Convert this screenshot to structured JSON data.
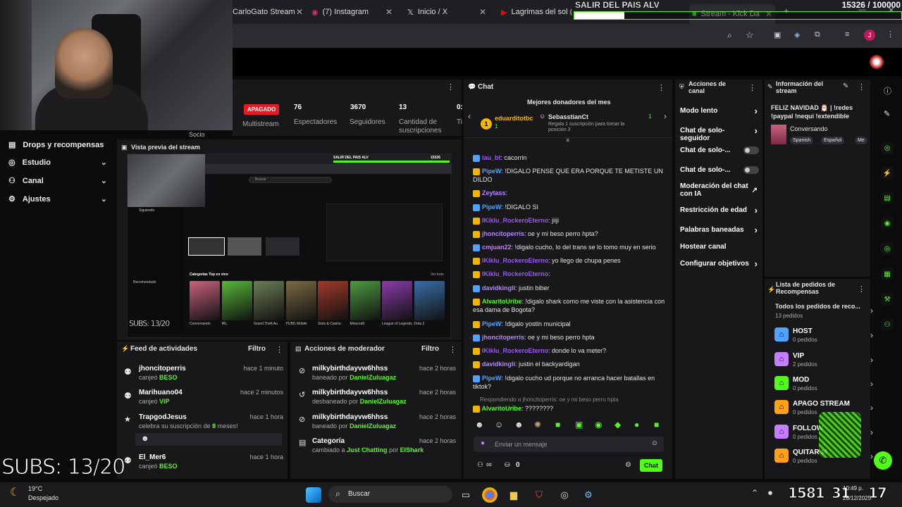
{
  "browser": {
    "tabs": [
      {
        "label": "CarloGato Stream"
      },
      {
        "label": "(7) Instagram"
      },
      {
        "label": "Inicio / X"
      },
      {
        "label": "Lagrimas del sol ("
      },
      {
        "label": "Stream - Kick Da"
      }
    ],
    "profile_initial": "J"
  },
  "overlay": {
    "goal_title": "SALIR DEL PAIS ALV",
    "goal_progress": "15326 / 100000",
    "goal_fraction": 0.153,
    "subs_big": "SUBS: 13/20",
    "subs_small": "SUBS: 13/20",
    "bottom_counter": "1581",
    "bottom_counter2": "31",
    "bottom_counter3": "17",
    "bottom_label1": "Socio"
  },
  "sidebar": {
    "items": [
      {
        "label": "Drops y recompensas",
        "icon": "gift-icon"
      },
      {
        "label": "Estudio",
        "icon": "target-icon"
      },
      {
        "label": "Canal",
        "icon": "people-icon"
      },
      {
        "label": "Ajustes",
        "icon": "gear-icon"
      }
    ]
  },
  "stats": {
    "status_badge": "APAGADO",
    "status_label": "Multistream",
    "viewers": "76",
    "viewers_label": "Espectadores",
    "followers": "3670",
    "followers_label": "Seguidores",
    "subs": "13",
    "subs_label": "Cantidad de suscripciones",
    "time": "0:",
    "time_label": "Ti"
  },
  "preview": {
    "title": "Vista previa del stream",
    "search_placeholder": "Buscar",
    "inner_title": "SALIR DEL PAIS ALV",
    "inner_progress": "15326",
    "categories_title": "Categorías Top en vivo",
    "see_all": "Ver todo",
    "following": "Siguiendo",
    "recommended": "Recomendado",
    "subs_overlay": "SUBS: 13/20",
    "categories": [
      {
        "label": "Conversando",
        "color": "#c9637d"
      },
      {
        "label": "IRL",
        "color": "#58b83a"
      },
      {
        "label": "Grand Theft Au",
        "color": "#6d7e55"
      },
      {
        "label": "PUBG Mobile",
        "color": "#7b6a44"
      },
      {
        "label": "Slots & Casino",
        "color": "#a23a2a"
      },
      {
        "label": "Minecraft",
        "color": "#4d9b40"
      },
      {
        "label": "League of Legends",
        "color": "#8a3ca9"
      },
      {
        "label": "Dota 2",
        "color": "#3a6fa8"
      }
    ]
  },
  "feed": {
    "title": "Feed de actividades",
    "filter": "Filtro",
    "items": [
      {
        "name": "jhoncitoperris",
        "action": "canjeó",
        "highlight": "BESO",
        "time": "hace 1 minuto"
      },
      {
        "name": "Marihuano04",
        "action": "canjeó",
        "highlight": "VIP",
        "time": "hace 2 minutos"
      },
      {
        "name": "TrapgodJesus",
        "action": "celebra su suscripción de",
        "highlight": "8",
        "action2": "meses!",
        "time": "hace 1 hora"
      },
      {
        "name": "El_Mer6",
        "action": "canjeó",
        "highlight": "BESO",
        "time": "hace 1 hora"
      }
    ]
  },
  "mod_actions": {
    "title": "Acciones de moderador",
    "filter": "Filtro",
    "items": [
      {
        "name": "milkybirthdayvw6hhss",
        "action": "baneado por",
        "by": "DanielZuluagaz",
        "time": "hace 2 horas"
      },
      {
        "name": "milkybirthdayvw6hhss",
        "action": "desbaneado por",
        "by": "DanielZuluagaz",
        "time": "hace 2 horas"
      },
      {
        "name": "milkybirthdayvw6hhss",
        "action": "baneado por",
        "by": "DanielZuluagaz",
        "time": "hace 2 horas"
      },
      {
        "name": "Categoría",
        "action": "cambiado a",
        "by": "Just Chatting",
        "action2": "por",
        "by2": "ElShark",
        "time": "hace 2 horas"
      }
    ]
  },
  "chat": {
    "title": "Chat",
    "donors_title": "Mejores donadores del mes",
    "donor1": "eduarditotbc",
    "donor1_count": "1",
    "donor2": "SebasstianCt",
    "donor2_count": "1",
    "donor2_sub": "Regala 1 suscripción para tomar la posición 3",
    "messages": [
      {
        "user": "lau_bt",
        "color": "#9b59f5",
        "text": "cacorrin"
      },
      {
        "user": "PipeW",
        "color": "#4fa3ff",
        "text": "!DIGALO PENSE QUE ERA PORQUE TE METISTE UN DILDO"
      },
      {
        "user": "Zeytass",
        "color": "#b388ff",
        "text": ""
      },
      {
        "user": "PipeW",
        "color": "#4fa3ff",
        "text": "!DIGALO SI"
      },
      {
        "user": "IKiklu_RockeroEterno",
        "color": "#9b59f5",
        "text": "jiiji"
      },
      {
        "user": "jhoncitoperris",
        "color": "#b388ff",
        "text": "oe y mi beso perro hpta?"
      },
      {
        "user": "cmjuan22",
        "color": "#c77dff",
        "text": "!digalo cucho, lo del trans se lo tomo muy en serio"
      },
      {
        "user": "IKiklu_RockeroEterno",
        "color": "#9b59f5",
        "text": "yo llego de chupa penes"
      },
      {
        "user": "IKiklu_RockeroEterno",
        "color": "#9b59f5",
        "text": ""
      },
      {
        "user": "davidkingli",
        "color": "#b388ff",
        "text": "justin biber"
      },
      {
        "user": "AlvaritoUribe",
        "color": "#53fc18",
        "text": "!digalo shark como me viste con la asistencia con esa dama de Bogota?"
      },
      {
        "user": "PipeW",
        "color": "#4fa3ff",
        "text": "!digalo yostin municipal"
      },
      {
        "user": "jhoncitoperris",
        "color": "#b388ff",
        "text": "oe y mi beso perro hpta"
      },
      {
        "user": "IKiklu_RockeroEterno",
        "color": "#9b59f5",
        "text": "donde lo va meter?"
      },
      {
        "user": "davidkingli",
        "color": "#b388ff",
        "text": "justin el backyardigan"
      },
      {
        "user": "PipeW",
        "color": "#4fa3ff",
        "text": "!digalo cucho ud porque no arranca hacer batallas en tiktok?"
      }
    ],
    "reply_context": "Respondiendo a jhoncitoperris: oe y mi beso perro hpta",
    "last_user": "AlvaritoUribe",
    "last_text": "????????",
    "input_placeholder": "Enviar un mensaje",
    "points": "0",
    "send_label": "Chat"
  },
  "actions": {
    "title": "Acciones de canal",
    "items": [
      {
        "label": "Modo lento",
        "control": "chevron"
      },
      {
        "label": "Chat de solo-seguidor",
        "control": "chevron"
      },
      {
        "label": "Chat de solo-...",
        "control": "toggle"
      },
      {
        "label": "Chat de solo-...",
        "control": "toggle"
      },
      {
        "label": "Moderación del chat con IA",
        "control": "external"
      },
      {
        "label": "Restricción de edad",
        "control": "chevron"
      },
      {
        "label": "Palabras baneadas",
        "control": "chevron"
      },
      {
        "label": "Hostear canal",
        "control": "none"
      },
      {
        "label": "Configurar objetivos",
        "control": "chevron"
      }
    ]
  },
  "stream_info": {
    "title": "Información del stream",
    "stream_title": "FELIZ NAVIDAD 🎅 | !redes !paypal !nequi !extendible",
    "category": "Conversando",
    "tags": [
      "Spanish",
      "Español",
      "Me"
    ]
  },
  "rewards": {
    "title": "Lista de pedidos de Recompensas",
    "all_title": "Todos los pedidos de reco...",
    "all_count": "13 pedidos",
    "items": [
      {
        "title": "HOST",
        "count": "0 pedidos",
        "color": "#4fa3ff"
      },
      {
        "title": "VIP",
        "count": "2 pedidos",
        "color": "#c77dff"
      },
      {
        "title": "MOD",
        "count": "0 pedidos",
        "color": "#53fc18"
      },
      {
        "title": "APAGO STREAM",
        "count": "0 pedidos",
        "color": "#ff9f1a"
      },
      {
        "title": "FOLLOW",
        "count": "0 pedidos",
        "color": "#c77dff"
      },
      {
        "title": "QUITAR M",
        "count": "0 pedidos",
        "color": "#ff9f1a"
      }
    ]
  },
  "taskbar": {
    "temp": "19°C",
    "weather": "Despejado",
    "search": "Buscar",
    "time": "10:49 p.",
    "date": "28/12/2025"
  }
}
